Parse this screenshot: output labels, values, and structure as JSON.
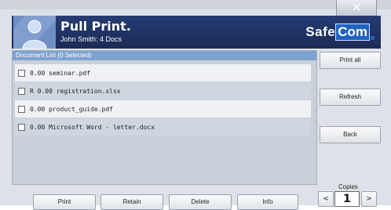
{
  "window": {
    "close_symbol": "✕"
  },
  "header": {
    "title": "Pull Print.",
    "subtitle": "John Smith: 4 Docs",
    "logo_part1": "Safe",
    "logo_part2": "Com"
  },
  "doclist": {
    "header": "Document List (0 Selected)",
    "items": [
      {
        "label": "0.00 seminar.pdf"
      },
      {
        "label": "R 0.00 registration.xlsx"
      },
      {
        "label": "0.00 product_guide.pdf"
      },
      {
        "label": "0.00 Microsoft Word - letter.docx"
      }
    ]
  },
  "side_buttons": {
    "print_all": "Print all",
    "refresh": "Refresh",
    "back": "Back"
  },
  "bottom_buttons": {
    "print": "Print",
    "retain": "Retain",
    "delete": "Delete",
    "info": "Info"
  },
  "copies": {
    "label": "Copies",
    "value": "1",
    "decrement": "<",
    "increment": ">"
  },
  "icons": {
    "avatar": "user-icon",
    "close": "close-icon"
  },
  "colors": {
    "header_bg": "#1f315f",
    "list_header": "#7fa2d0",
    "logo_accent": "#1e63c2"
  }
}
